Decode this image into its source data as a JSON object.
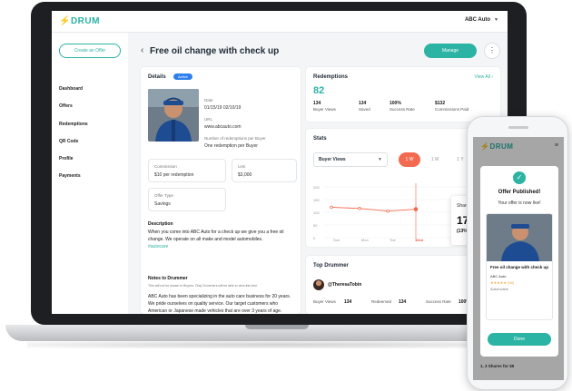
{
  "app": {
    "logo": "DRUM",
    "account": "ABC Auto"
  },
  "sidebar": {
    "create_button": "Create an Offer",
    "items": [
      "Dashboard",
      "Offers",
      "Redemptions",
      "QR Code",
      "Profile",
      "Payments"
    ]
  },
  "page": {
    "title": "Free oil change with check up",
    "manage_button": "Manage"
  },
  "details": {
    "heading": "Details",
    "status": "Active",
    "date_label": "Date",
    "date_value": "01/15/19   02/10/19",
    "url_label": "URL",
    "url_value": "www.abcauto.com",
    "limit_label": "Number of redemptions per Buyer",
    "limit_value": "One redemption per Buyer",
    "commission_label": "Commission",
    "commission_value": "$10 per redemption",
    "limit_box_label": "Limi",
    "limit_box_value": "$3,000",
    "offer_type_label": "Offer Type",
    "offer_type_value": "Savings",
    "description_label": "Description",
    "description_text": "When you come into ABC Auto for a check up we give you a free oil change. We operate on all make and model automobiles.",
    "hashtag": "#autocare",
    "notes_label": "Notes to Drummer",
    "notes_hint": "This will not be shown to Buyers. Only Drummers will be able to view this text.",
    "notes_text": "ABC Auto has been specializing in the auto care business for 20 years. We pride ourselves on quality service. Our target customers who American or Japanese made vehicles that are over 3 years of age."
  },
  "redemptions": {
    "heading": "Redemptions",
    "view_all": "View All",
    "total": "82",
    "stats": [
      {
        "value": "134",
        "label": "Buyer Views"
      },
      {
        "value": "134",
        "label": "Saved"
      },
      {
        "value": "100%",
        "label": "Success Rate"
      },
      {
        "value": "$132",
        "label": "Commissions Paid"
      }
    ]
  },
  "stats": {
    "heading": "Stats",
    "select_value": "Buyer Views",
    "ranges": [
      "1 W",
      "1 M",
      "1 Y"
    ],
    "active_range": "1 W",
    "tooltip_label": "Shared",
    "tooltip_value": "179",
    "tooltip_sub": "(13% of total)",
    "accent_color": "#f26a4f"
  },
  "chart_data": {
    "type": "line",
    "x": [
      "Sun",
      "Mon",
      "Tue",
      "Wed"
    ],
    "values": [
      120,
      115,
      105,
      112
    ],
    "y_ticks": [
      "200",
      "150",
      "100",
      "50",
      "0"
    ],
    "ylim": [
      0,
      200
    ]
  },
  "top_drummer": {
    "heading": "Top Drummer",
    "name": "@TheresaTobin",
    "stats": [
      {
        "label": "Buyer Views",
        "value": "134"
      },
      {
        "label": "Redeemed",
        "value": "134"
      },
      {
        "label": "Success Rate",
        "value": "100%"
      }
    ]
  },
  "phone": {
    "logo": "DRUM",
    "modal_title": "Offer Published!",
    "modal_sub": "Your offer is now live!",
    "offer_title": "Free oil change with check up",
    "offer_company": "ABC Auto",
    "offer_rating": "★★★★★ (58)",
    "offer_category": "Automotive",
    "done_button": "Done",
    "footer_label": "1, 3 Shares for $5",
    "footer_cols": [
      "Buyer Views",
      "Saved",
      "Redeemed"
    ],
    "footer_vals": [
      "134",
      "134",
      "134"
    ]
  }
}
